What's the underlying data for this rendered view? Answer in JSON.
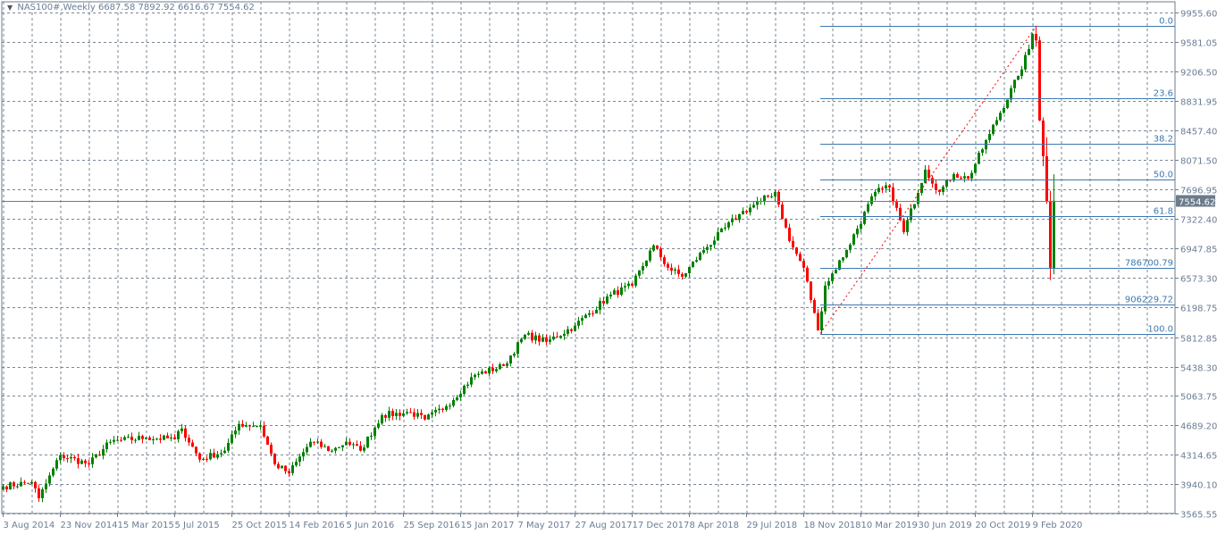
{
  "header": {
    "symbol": "NAS100#,Weekly",
    "ohlc": "6687.58 7892.92 6616.67 7554.62",
    "menu_icon": "triangle-down-icon"
  },
  "colors": {
    "bull": "#008000",
    "bear": "#ff0000",
    "grid": "#7a8796",
    "fib": "#3d78b0",
    "axis_text": "#6a7d94",
    "price_tag": "#6c7b8b"
  },
  "chart_data": {
    "type": "candlestick",
    "title": "NAS100#,Weekly",
    "ylim": [
      3565.55,
      9955.6
    ],
    "y_ticks": [
      "9955.60",
      "9581.05",
      "9206.50",
      "8831.95",
      "8457.40",
      "8071.50",
      "7696.95",
      "7322.40",
      "6947.85",
      "6573.30",
      "6198.75",
      "5812.85",
      "5438.30",
      "5063.75",
      "4689.20",
      "4314.65",
      "3940.10",
      "3565.55"
    ],
    "x_ticks": [
      "3 Aug 2014",
      "23 Nov 2014",
      "15 Mar 2015",
      "5 Jul 2015",
      "25 Oct 2015",
      "14 Feb 2016",
      "5 Jun 2016",
      "25 Sep 2016",
      "15 Jan 2017",
      "7 May 2017",
      "27 Aug 2017",
      "17 Dec 2017",
      "8 Apr 2018",
      "29 Jul 2018",
      "18 Nov 2018",
      "10 Mar 2019",
      "30 Jun 2019",
      "20 Oct 2019",
      "9 Feb 2020"
    ],
    "x_tick_week_step": 16,
    "weekly_close_anchors": [
      [
        0,
        3910
      ],
      [
        8,
        3967
      ],
      [
        10,
        3760
      ],
      [
        16,
        4308
      ],
      [
        24,
        4195
      ],
      [
        30,
        4480
      ],
      [
        40,
        4535
      ],
      [
        48,
        4512
      ],
      [
        50,
        4650
      ],
      [
        55,
        4252
      ],
      [
        62,
        4366
      ],
      [
        66,
        4707
      ],
      [
        72,
        4684
      ],
      [
        76,
        4195
      ],
      [
        80,
        4080
      ],
      [
        86,
        4480
      ],
      [
        92,
        4366
      ],
      [
        96,
        4480
      ],
      [
        100,
        4366
      ],
      [
        106,
        4820
      ],
      [
        114,
        4855
      ],
      [
        118,
        4764
      ],
      [
        124,
        4935
      ],
      [
        132,
        5333
      ],
      [
        140,
        5447
      ],
      [
        146,
        5846
      ],
      [
        152,
        5755
      ],
      [
        160,
        5960
      ],
      [
        170,
        6358
      ],
      [
        176,
        6472
      ],
      [
        182,
        6984
      ],
      [
        186,
        6700
      ],
      [
        190,
        6586
      ],
      [
        196,
        6927
      ],
      [
        206,
        7383
      ],
      [
        212,
        7553
      ],
      [
        216,
        7667
      ],
      [
        220,
        7041
      ],
      [
        224,
        6700
      ],
      [
        228,
        5900
      ],
      [
        230,
        6472
      ],
      [
        236,
        6927
      ],
      [
        244,
        7667
      ],
      [
        248,
        7724
      ],
      [
        252,
        7155
      ],
      [
        258,
        7952
      ],
      [
        262,
        7667
      ],
      [
        266,
        7895
      ],
      [
        270,
        7838
      ],
      [
        276,
        8407
      ],
      [
        284,
        9147
      ],
      [
        287,
        9489
      ],
      [
        288,
        9682
      ],
      [
        289,
        9600
      ],
      [
        290,
        8578
      ],
      [
        291,
        8122
      ],
      [
        292,
        7553
      ],
      [
        293,
        6700
      ]
    ],
    "last_bar": {
      "open": 6687.58,
      "high": 7892.92,
      "low": 6616.67,
      "close": 7554.62
    },
    "current_price": "7554.62",
    "fibonacci": {
      "high": 9786.3,
      "low": 5860.7,
      "levels": [
        {
          "ratio": 0.0,
          "label": "0.0"
        },
        {
          "ratio": 0.236,
          "label": "23.6"
        },
        {
          "ratio": 0.382,
          "label": "38.2"
        },
        {
          "ratio": 0.5,
          "label": "50.0"
        },
        {
          "ratio": 0.618,
          "label": "61.8"
        },
        {
          "ratio": 0.786,
          "label": "786700.79"
        },
        {
          "ratio": 0.906,
          "label": "906229.72"
        },
        {
          "ratio": 1.0,
          "label": "100.0"
        }
      ],
      "start_week": 229,
      "end_week": 289
    }
  }
}
